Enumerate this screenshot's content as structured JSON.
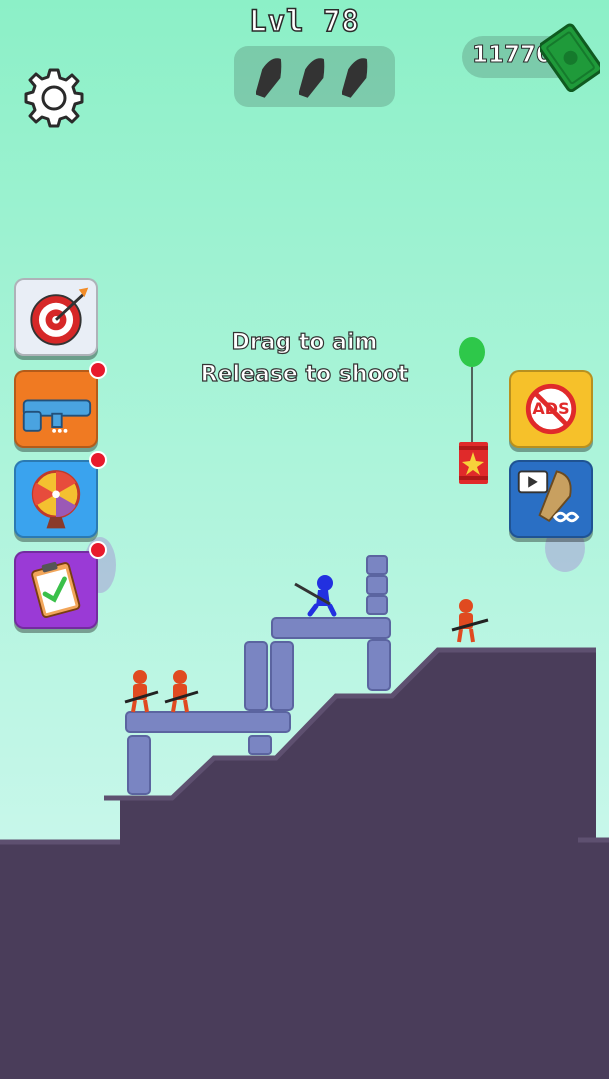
{
  "hud": {
    "level_label": "Lvl 78",
    "bullets_remaining": 3,
    "cash": "11770"
  },
  "hint": {
    "line1": "Drag to aim",
    "line2": "Release to shoot"
  },
  "side_buttons_left": [
    {
      "name": "target-button",
      "icon": "target-icon",
      "notification": false
    },
    {
      "name": "weapon-shop-button",
      "icon": "rifle-icon",
      "notification": true
    },
    {
      "name": "prize-wheel-button",
      "icon": "wheel-icon",
      "notification": true
    },
    {
      "name": "tasks-button",
      "icon": "clipboard-icon",
      "notification": true
    }
  ],
  "side_buttons_right": [
    {
      "name": "no-ads-button",
      "icon": "no-ads-icon",
      "badge_text": "ADS"
    },
    {
      "name": "infinite-ammo-button",
      "icon": "infinite-bullet-icon"
    }
  ],
  "colors": {
    "sky_top": "#8cf0c7",
    "sky_bottom": "#d8f9f4",
    "ground": "#4a3d5a",
    "block": "#7a85c2",
    "player": "#2230e0",
    "enemy": "#e04a20",
    "balloon": "#2ec84a",
    "barrel": "#e02a2a"
  },
  "enemies": 3
}
